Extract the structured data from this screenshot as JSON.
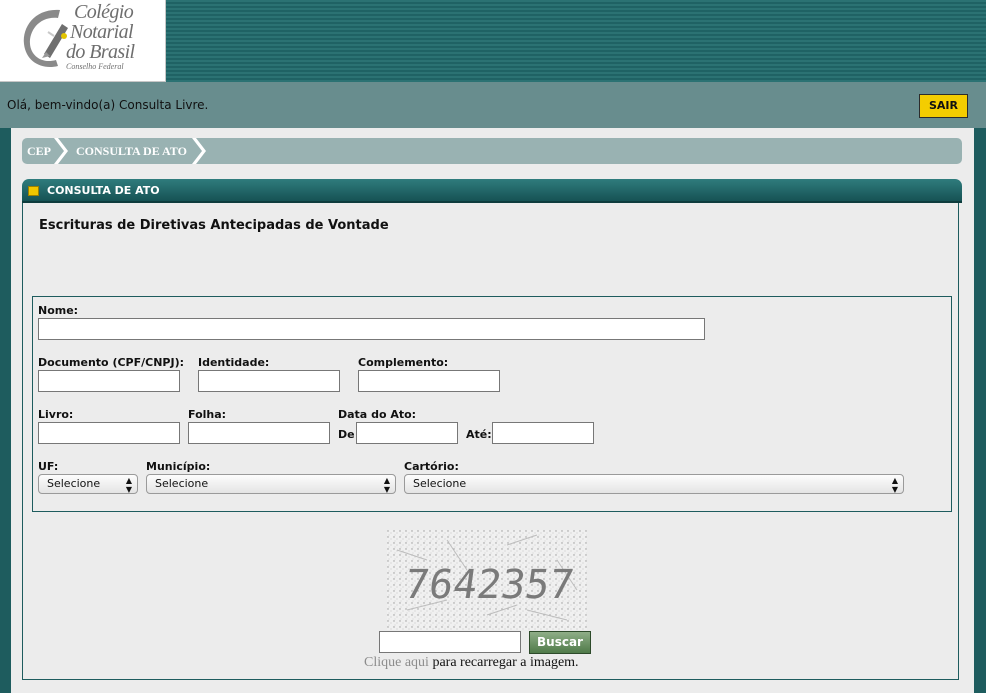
{
  "header": {
    "logo": {
      "line1": "Colégio",
      "line2": "Notarial",
      "line3": "do Brasil",
      "line4": "Conselho Federal"
    },
    "welcome_text": "Olá, bem-vindo(a) Consulta Livre.",
    "logout_label": "SAIR"
  },
  "breadcrumb": {
    "items": [
      "CEP",
      "CONSULTA DE ATO"
    ]
  },
  "panel": {
    "title": "CONSULTA DE ATO",
    "section_title": "Escrituras de Diretivas Antecipadas de Vontade"
  },
  "form": {
    "nome_label": "Nome:",
    "nome_value": "",
    "documento_label": "Documento (CPF/CNPJ):",
    "documento_value": "",
    "identidade_label": "Identidade:",
    "identidade_value": "",
    "complemento_label": "Complemento:",
    "complemento_value": "",
    "livro_label": "Livro:",
    "livro_value": "",
    "folha_label": "Folha:",
    "folha_value": "",
    "data_ato_label": "Data do Ato:",
    "de_label": "De",
    "de_value": "",
    "ate_label": "Até:",
    "ate_value": "",
    "uf_label": "UF:",
    "uf_selected": "Selecione",
    "municipio_label": "Município:",
    "municipio_selected": "Selecione",
    "cartorio_label": "Cartório:",
    "cartorio_selected": "Selecione"
  },
  "captcha": {
    "code": "7642357",
    "input_value": "",
    "search_label": "Buscar",
    "reload_link": "Clique aqui",
    "reload_suffix": " para recarregar a imagem."
  },
  "colors": {
    "header_teal": "#1e5c5e",
    "welcome_bar": "#688d8e",
    "logout_yellow": "#f4cd00",
    "breadcrumb_bg": "#99b2b2",
    "buscar_green": "#5e8a57"
  }
}
